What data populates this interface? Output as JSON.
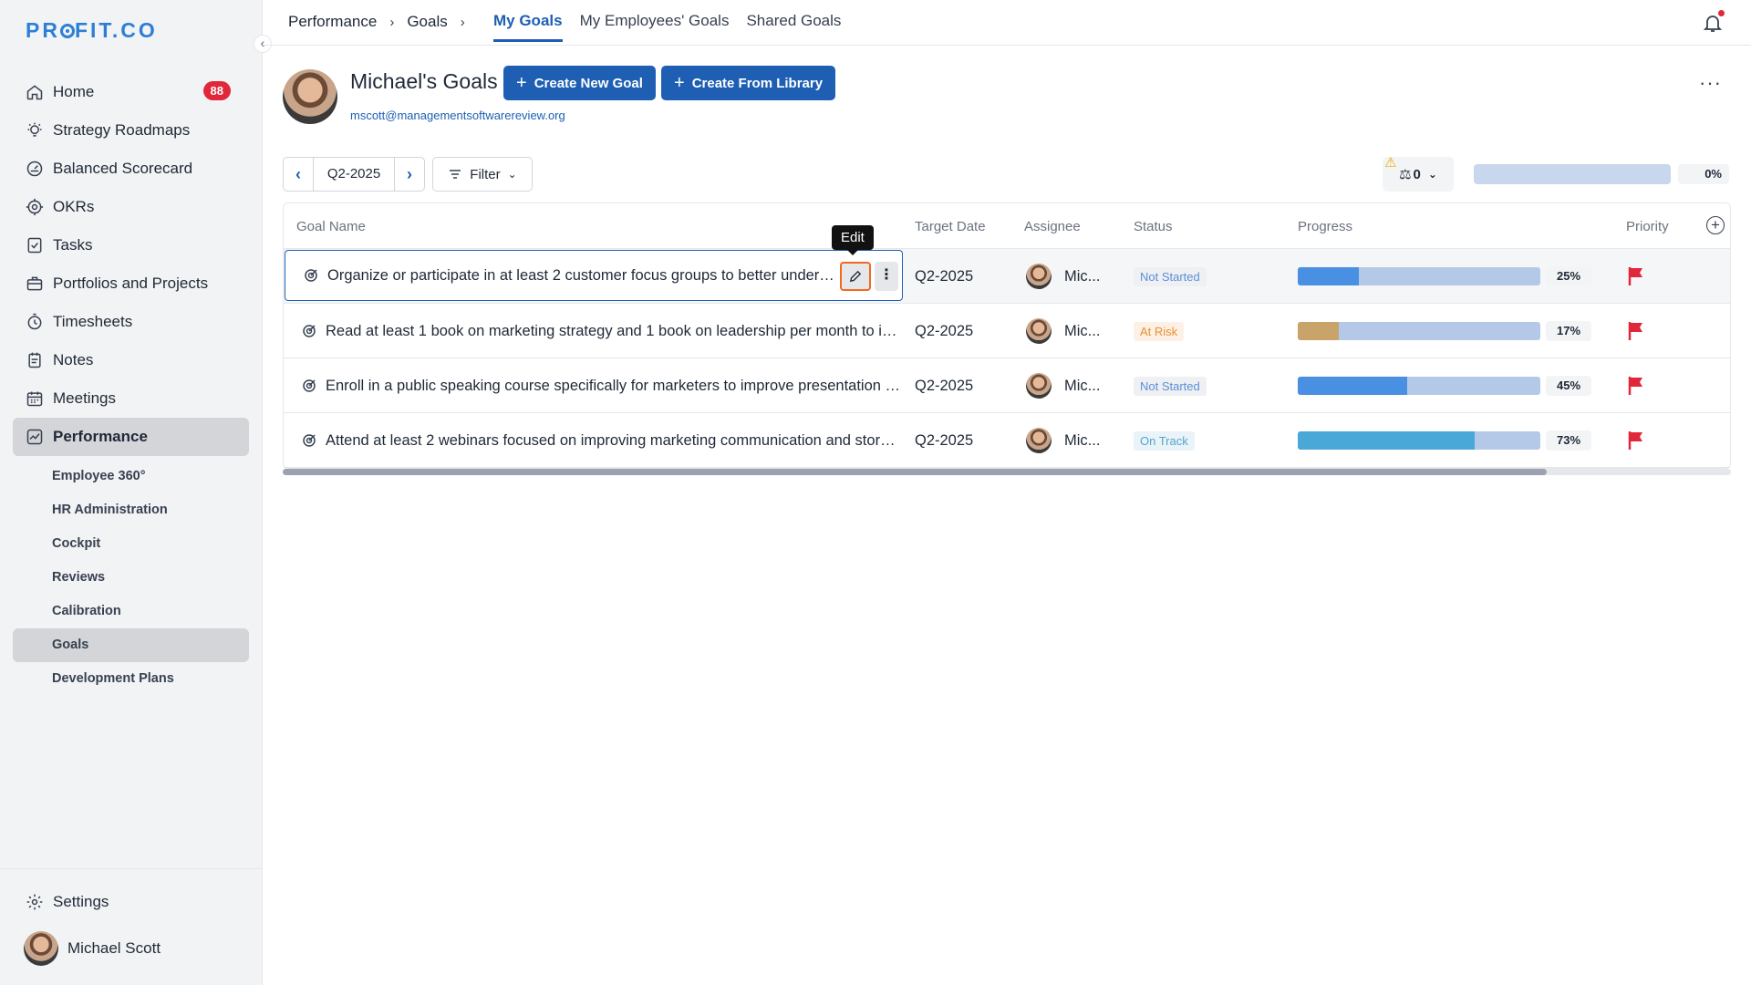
{
  "sidebar": {
    "logo": "PROFIT.CO",
    "nav": [
      {
        "label": "Home",
        "icon": "home-icon",
        "badge": "88"
      },
      {
        "label": "Strategy Roadmaps",
        "icon": "bulb-icon"
      },
      {
        "label": "Balanced Scorecard",
        "icon": "gauge-icon"
      },
      {
        "label": "OKRs",
        "icon": "target-icon"
      },
      {
        "label": "Tasks",
        "icon": "checklist-icon"
      },
      {
        "label": "Portfolios and Projects",
        "icon": "briefcase-icon"
      },
      {
        "label": "Timesheets",
        "icon": "stopwatch-icon"
      },
      {
        "label": "Notes",
        "icon": "notepad-icon"
      },
      {
        "label": "Meetings",
        "icon": "calendar-icon"
      },
      {
        "label": "Performance",
        "icon": "chart-icon"
      }
    ],
    "subnav": [
      "Employee 360°",
      "HR Administration",
      "Cockpit",
      "Reviews",
      "Calibration",
      "Goals",
      "Development Plans"
    ],
    "settings": "Settings",
    "user": "Michael Scott"
  },
  "topbar": {
    "crumbs": [
      "Performance",
      "Goals"
    ],
    "tabs": [
      "My Goals",
      "My Employees' Goals",
      "Shared Goals"
    ]
  },
  "header": {
    "title": "Michael's Goals",
    "create_new": "Create New Goal",
    "create_library": "Create From Library",
    "email": "mscott@managementsoftwarereview.org"
  },
  "toolbar": {
    "period": "Q2-2025",
    "filter": "Filter",
    "weight": "0",
    "overall_progress": "0%"
  },
  "table": {
    "columns": [
      "Goal Name",
      "Target Date",
      "Assignee",
      "Status",
      "Progress",
      "Priority"
    ],
    "tooltip": "Edit",
    "rows": [
      {
        "goal": "Organize or participate in at least 2 customer focus groups to better unders...",
        "date": "Q2-2025",
        "assignee": "Mic...",
        "status": "Not Started",
        "progress": 25,
        "progress_label": "25%"
      },
      {
        "goal": "Read at least 1 book on marketing strategy and 1 book on leadership per month to im...",
        "date": "Q2-2025",
        "assignee": "Mic...",
        "status": "At Risk",
        "progress": 17,
        "progress_label": "17%"
      },
      {
        "goal": "Enroll in a public speaking course specifically for marketers to improve presentation a...",
        "date": "Q2-2025",
        "assignee": "Mic...",
        "status": "Not Started",
        "progress": 45,
        "progress_label": "45%"
      },
      {
        "goal": "Attend at least 2 webinars focused on improving marketing communication and storyt...",
        "date": "Q2-2025",
        "assignee": "Mic...",
        "status": "On Track",
        "progress": 73,
        "progress_label": "73%"
      }
    ]
  },
  "colors": {
    "primary": "#1e5fb3",
    "not_started_fill": "#4a90e2",
    "at_risk_fill": "#c8a36a",
    "on_track_fill": "#4aa8d8",
    "flag": "#e0283a"
  }
}
